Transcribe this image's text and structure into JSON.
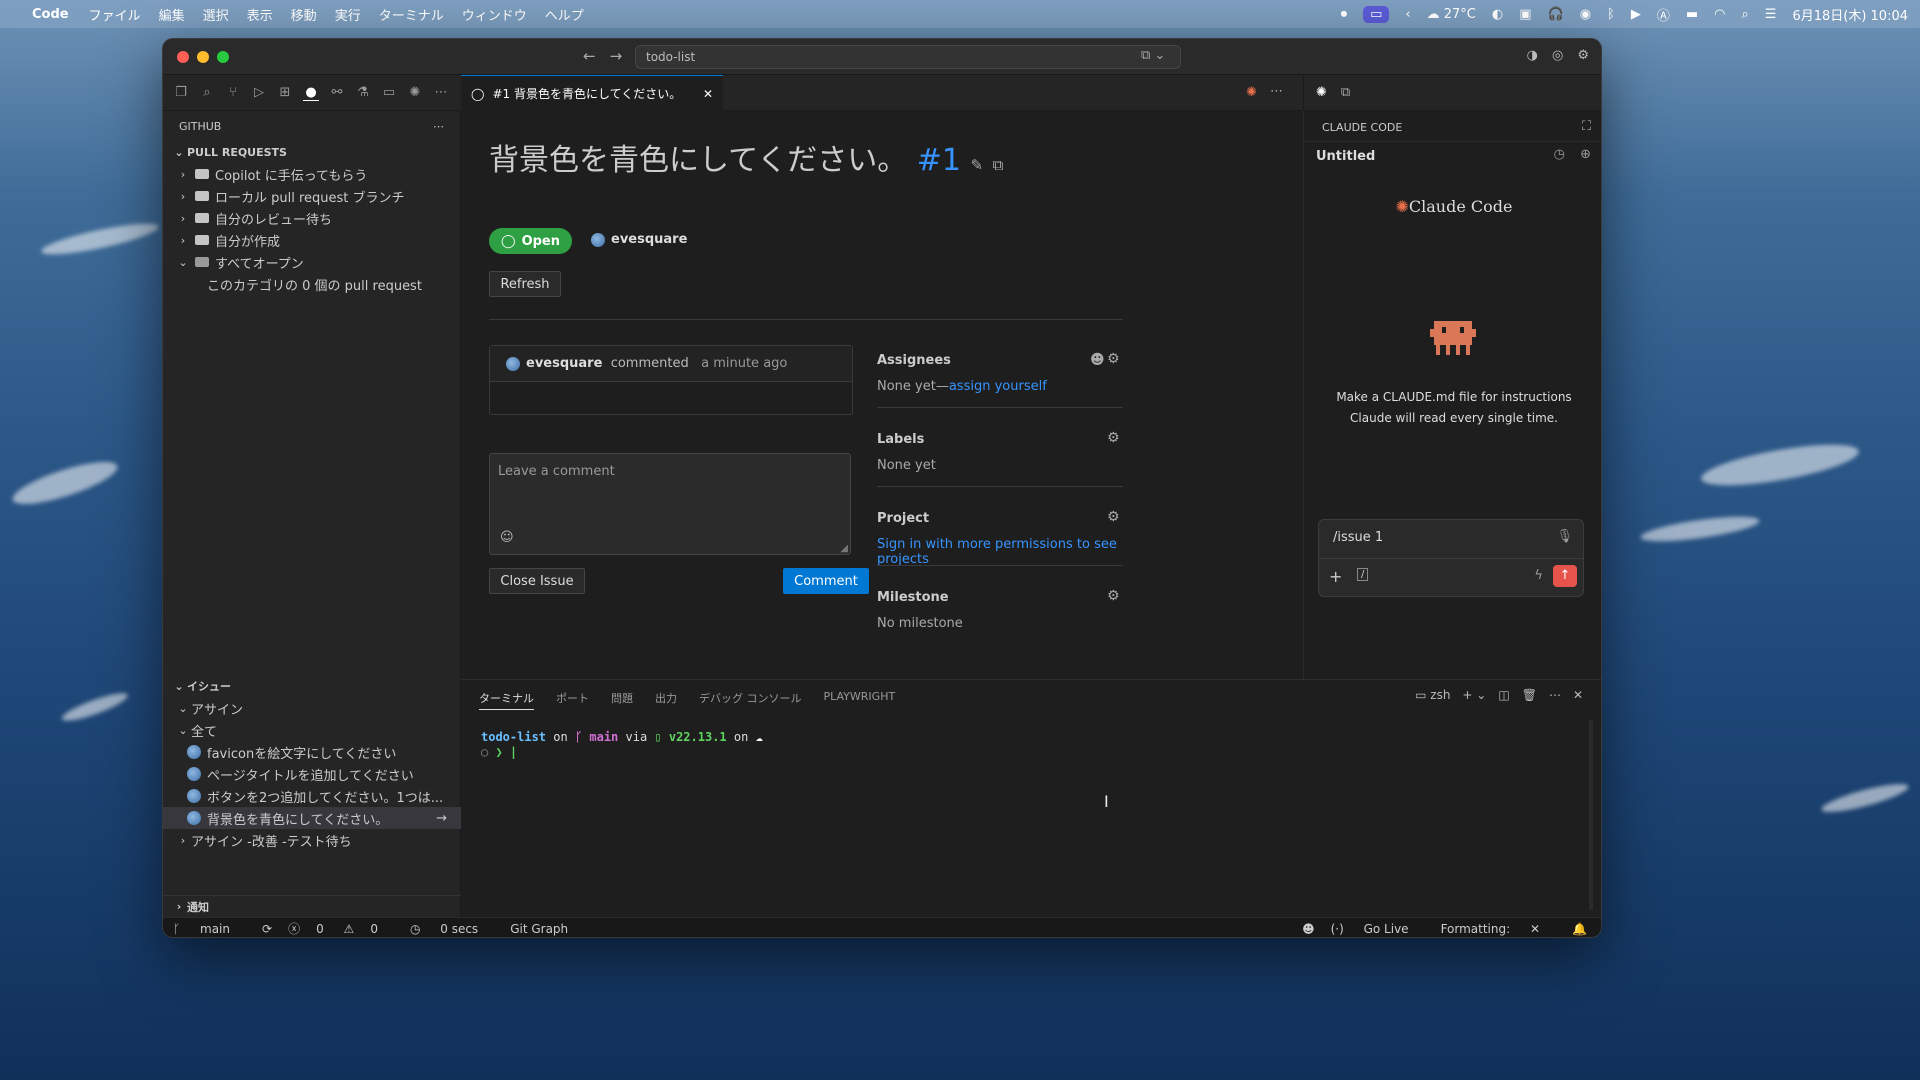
{
  "menubar": {
    "app": "Code",
    "items": [
      "ファイル",
      "編集",
      "選択",
      "表示",
      "移動",
      "実行",
      "ターミナル",
      "ウィンドウ",
      "ヘルプ"
    ],
    "weather": "27°C",
    "datetime": "6月18日(木)  10:04"
  },
  "titlebar": {
    "search": "todo-list"
  },
  "sidebar": {
    "title": "GITHUB",
    "pr_section": "PULL REQUESTS",
    "pr_items": [
      "Copilot に手伝ってもらう",
      "ローカル pull request ブランチ",
      "自分のレビュー待ち",
      "自分が作成",
      "すべてオープン"
    ],
    "pr_empty": "このカテゴリの 0 個の pull request",
    "issues_section": "イシュー",
    "issues_group1": "アサイン",
    "issues_group2": "全て",
    "issues": [
      "faviconを絵文字にしてください",
      "ページタイトルを追加してください",
      "ボタンを2つ追加してください。1つは...",
      "背景色を青色にしてください。"
    ],
    "issues_group3": "アサイン -改善 -テスト待ち",
    "notify_section": "通知"
  },
  "tab": {
    "label": "#1 背景色を青色にしてください。"
  },
  "issue": {
    "title": "背景色を青色にしてください。",
    "number": "#1",
    "state": "Open",
    "author": "evesquare",
    "refresh": "Refresh",
    "comment_author": "evesquare",
    "comment_verb": "commented",
    "comment_time": "a minute ago",
    "comment_placeholder": "Leave a comment",
    "close_button": "Close Issue",
    "comment_button": "Comment",
    "assignees_label": "Assignees",
    "assignees_none": "None yet—",
    "assign_yourself": "assign yourself",
    "labels_label": "Labels",
    "labels_value": "None yet",
    "project_label": "Project",
    "project_value": "Sign in with more permissions to see projects",
    "milestone_label": "Milestone",
    "milestone_value": "No milestone"
  },
  "claude": {
    "panel_title": "CLAUDE CODE",
    "session": "Untitled",
    "logo": "Claude Code",
    "hint1": "Make a CLAUDE.md file for instructions",
    "hint2": "Claude will read every single time.",
    "input": "/issue 1"
  },
  "panel": {
    "tabs": [
      "ターミナル",
      "ポート",
      "問題",
      "出力",
      "デバッグ コンソール",
      "PLAYWRIGHT"
    ],
    "shell": "zsh",
    "line_dir": "todo-list",
    "line_on": " on ",
    "line_branch": "main",
    "line_via": " via ",
    "line_node": "v22.13.1",
    "line_on2": " on ",
    "prompt": "❯ |"
  },
  "status": {
    "branch": "main",
    "errors": "0",
    "warnings": "0",
    "time": "0 secs",
    "gitgraph": "Git Graph",
    "golive": "Go Live",
    "formatting": "Formatting:"
  }
}
